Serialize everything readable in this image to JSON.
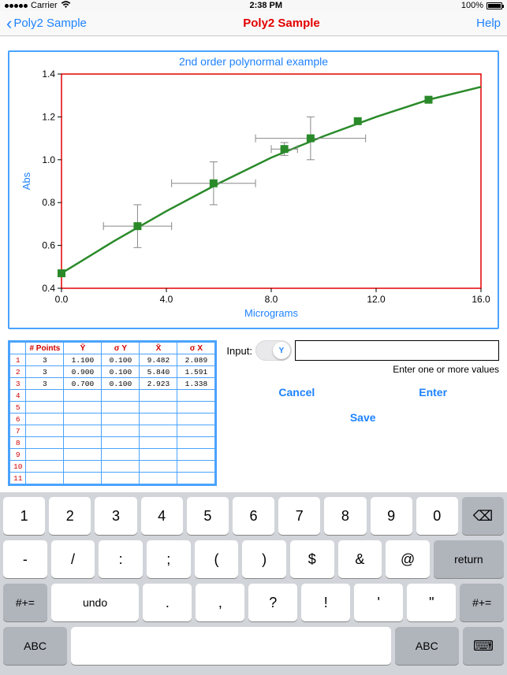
{
  "status": {
    "carrier": "Carrier",
    "wifi_icon": "wifi",
    "time": "2:38 PM",
    "battery_pct": "100%"
  },
  "nav": {
    "back_label": "Poly2 Sample",
    "title": "Poly2 Sample",
    "help_label": "Help"
  },
  "chart_data": {
    "type": "scatter",
    "title": "2nd order polynormal example",
    "xlabel": "Micrograms",
    "ylabel": "Abs",
    "xlim": [
      0.0,
      16.0
    ],
    "ylim": [
      0.4,
      1.4
    ],
    "xticks": [
      0.0,
      4.0,
      8.0,
      12.0,
      16.0
    ],
    "yticks": [
      0.4,
      0.6,
      0.8,
      1.0,
      1.2,
      1.4
    ],
    "points": [
      {
        "x": 0.0,
        "y": 0.47,
        "ex": 0.0,
        "ey": 0.0
      },
      {
        "x": 2.9,
        "y": 0.69,
        "ex": 1.3,
        "ey": 0.1
      },
      {
        "x": 5.8,
        "y": 0.89,
        "ex": 1.6,
        "ey": 0.1
      },
      {
        "x": 8.5,
        "y": 1.05,
        "ex": 0.5,
        "ey": 0.03
      },
      {
        "x": 9.5,
        "y": 1.1,
        "ex": 2.1,
        "ey": 0.1
      },
      {
        "x": 11.3,
        "y": 1.18,
        "ex": 0.0,
        "ey": 0.0
      },
      {
        "x": 14.0,
        "y": 1.28,
        "ex": 0.0,
        "ey": 0.0
      }
    ],
    "fit_curve": [
      {
        "x": 0.0,
        "y": 0.47
      },
      {
        "x": 2.0,
        "y": 0.62
      },
      {
        "x": 4.0,
        "y": 0.76
      },
      {
        "x": 6.0,
        "y": 0.89
      },
      {
        "x": 8.0,
        "y": 1.01
      },
      {
        "x": 10.0,
        "y": 1.11
      },
      {
        "x": 12.0,
        "y": 1.2
      },
      {
        "x": 14.0,
        "y": 1.28
      },
      {
        "x": 16.0,
        "y": 1.34
      }
    ]
  },
  "table": {
    "headers": [
      "# Points",
      "Ȳ",
      "σ Y",
      "X̄",
      "σ X"
    ],
    "rows": [
      [
        "3",
        "1.100",
        "0.100",
        "9.482",
        "2.089"
      ],
      [
        "3",
        "0.900",
        "0.100",
        "5.840",
        "1.591"
      ],
      [
        "3",
        "0.700",
        "0.100",
        "2.923",
        "1.338"
      ]
    ],
    "total_rows": 11
  },
  "input_panel": {
    "label": "Input:",
    "toggle_value": "Y",
    "field_value": "",
    "hint": "Enter one or more values",
    "cancel": "Cancel",
    "enter": "Enter",
    "save": "Save"
  },
  "keyboard": {
    "row1": [
      "1",
      "2",
      "3",
      "4",
      "5",
      "6",
      "7",
      "8",
      "9",
      "0"
    ],
    "row1_bksp": "⌫",
    "row2": [
      "-",
      "/",
      ":",
      ";",
      "(",
      ")",
      "$",
      "&",
      "@"
    ],
    "row2_return": "return",
    "row3_left": "#+=",
    "row3_undo": "undo",
    "row3_punct": [
      ".",
      ",",
      "?",
      "!",
      "'",
      "\""
    ],
    "row3_right": "#+=",
    "row4_abc_left": "ABC",
    "row4_abc_right": "ABC",
    "row4_dismiss": "⌨"
  }
}
